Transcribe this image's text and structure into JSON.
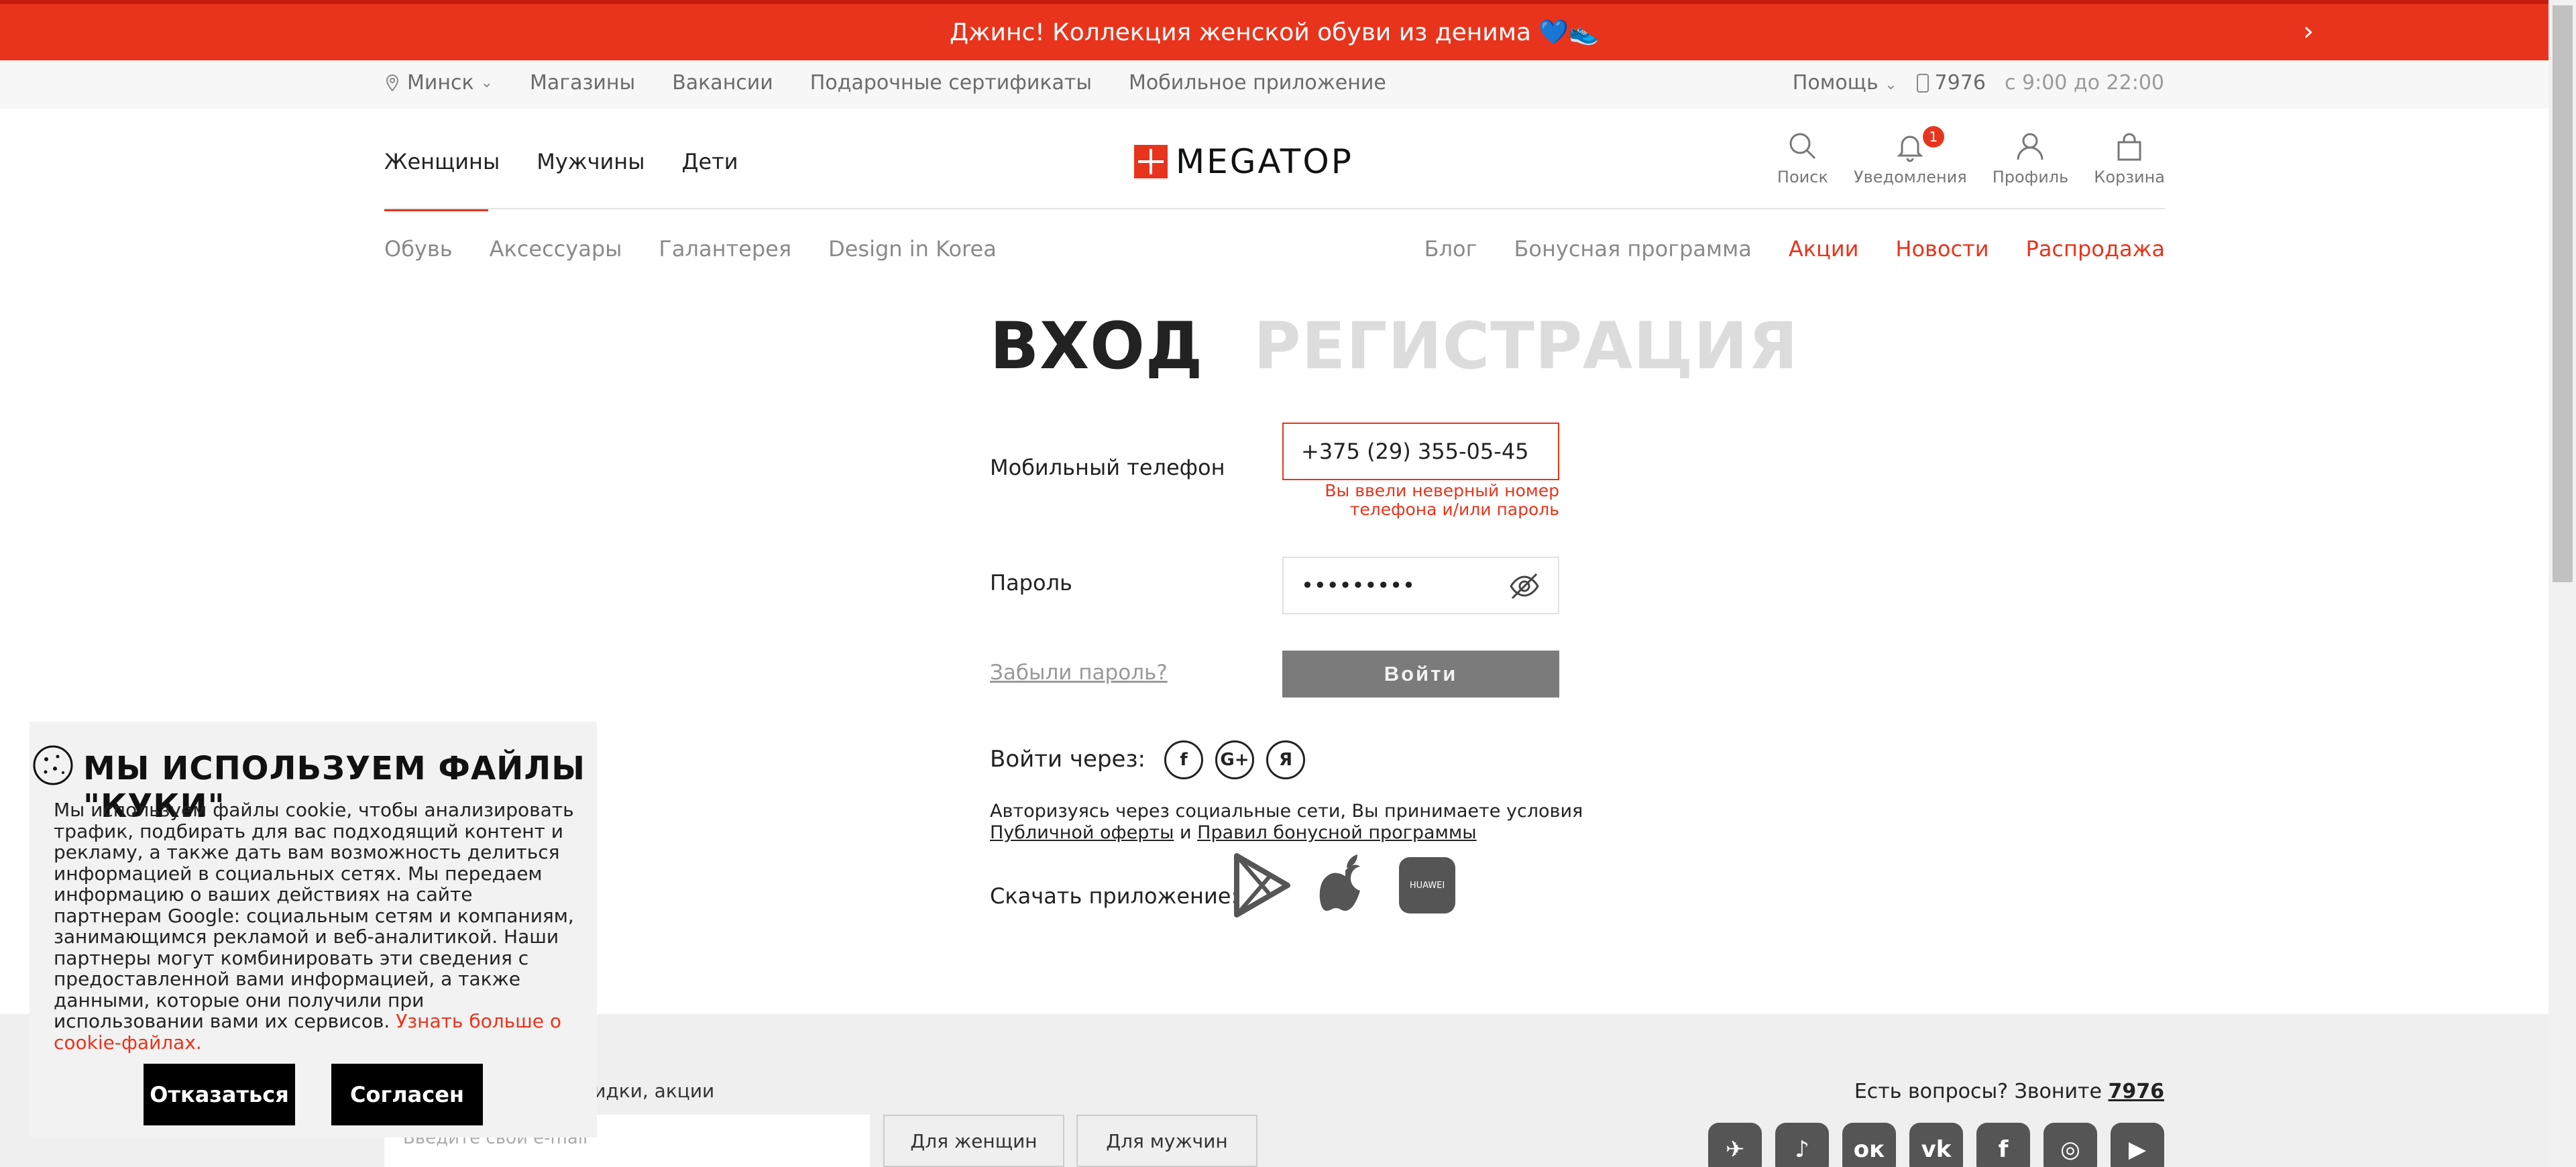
{
  "promo": {
    "text": "Джинс! Коллекция женской обуви из денима 💙👟",
    "arrow": "›"
  },
  "utility": {
    "city": "Минск",
    "links": [
      "Магазины",
      "Вакансии",
      "Подарочные сертификаты",
      "Мобильное приложение"
    ],
    "help": "Помощь",
    "phone": "7976",
    "hours": "с 9:00 до 22:00"
  },
  "header": {
    "gender_nav": [
      "Женщины",
      "Мужчины",
      "Дети"
    ],
    "logo_text": "MEGATOP",
    "icons": {
      "search": "Поиск",
      "notifications": "Уведомления",
      "notifications_count": "1",
      "profile": "Профиль",
      "cart": "Корзина"
    }
  },
  "categories": {
    "left": [
      "Обувь",
      "Аксессуары",
      "Галантерея",
      "Design in Korea"
    ],
    "right": [
      "Блог",
      "Бонусная программа"
    ],
    "right_red": [
      "Акции",
      "Новости",
      "Распродажа"
    ]
  },
  "login": {
    "tab_login": "ВХОД",
    "tab_register": "РЕГИСТРАЦИЯ",
    "phone_label": "Мобильный телефон",
    "phone_value": "+375 (29) 355-05-45",
    "error": "Вы ввели неверный номер телефона и/или пароль",
    "password_label": "Пароль",
    "password_value": "•••••••••",
    "forgot": "Забыли пароль?",
    "submit": "Войти",
    "social_label": "Войти через:",
    "social": [
      "f",
      "G+",
      "Я"
    ],
    "terms_prefix": "Авторизуясь через социальные сети, Вы принимаете условия",
    "terms_link1": "Публичной оферты",
    "terms_and": "и",
    "terms_link2": "Правил бонусной программы",
    "app_label": "Скачать приложение:",
    "huawei": "HUAWEI"
  },
  "footer": {
    "sub_text": "ки, скидки, акции",
    "email_placeholder": "Введите свой e-mail",
    "btn_women": "Для женщин",
    "btn_men": "Для мужчин",
    "questions": "Есть вопросы? Звоните",
    "questions_phone": "7976",
    "social": [
      "✈",
      "♪",
      "ок",
      "vk",
      "f",
      "◎",
      "▶"
    ]
  },
  "cookie": {
    "title": "МЫ ИСПОЛЬЗУЕМ ФАЙЛЫ \"КУКИ\"",
    "body": "Мы используем файлы cookie, чтобы анализировать трафик, подбирать для вас подходящий контент и рекламу, а также дать вам возможность делиться информацией в социальных сетях. Мы передаем информацию о ваших действиях на сайте партнерам Google: социальным сетям и компаниям, занимающимся рекламой и веб-аналитикой. Наши партнеры могут комбинировать эти сведения с предоставленной вами информацией, а также данными, которые они получили при использовании вами их сервисов.",
    "link": "Узнать больше о cookie-файлах.",
    "decline": "Отказаться",
    "accept": "Согласен"
  }
}
